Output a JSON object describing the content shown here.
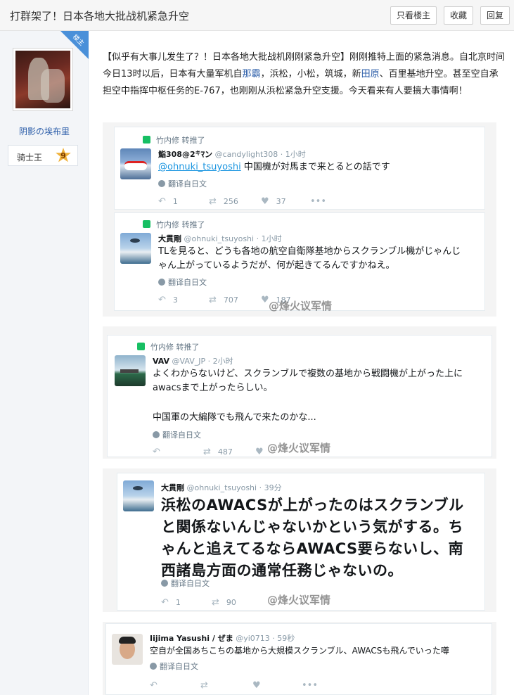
{
  "header": {
    "title": "打群架了！日本各地大批战机紧急升空",
    "buttons": {
      "author_only": "只看楼主",
      "favorite": "收藏",
      "reply": "回复"
    }
  },
  "user": {
    "corner_label": "楼主",
    "name": "阴影の埃布里",
    "rank_title": "骑士王",
    "rank_level": "9"
  },
  "post": {
    "text_before_naba": "【似乎有大事儿发生了？！日本各地大批战机刚刚紧急升空】刚刚推特上面的紧急消息。自北京时间今日13时以后，日本有大量军机自",
    "link_naba": "那霸",
    "text_between": "，浜松，小松，筑城，新",
    "link_tahara": "田原",
    "text_after": "、百里基地升空。甚至空自承担空中指挥中枢任务的E-767，也刚刚从浜松紧急升空支援。今天看来有人要搞大事情啊！"
  },
  "tweets": [
    {
      "retweet_label": "竹内修 转推了",
      "name": "鮨308@2",
      "name_suffix": "ﾏン",
      "handle": "@candylight308 · 1小时",
      "mention": "@ohnuki_tsuyoshi",
      "text": " 中国機が対馬まで来とるとの話です",
      "translate": "翻译自日文",
      "reply_count": "1",
      "retweet_count": "256",
      "like_count": "37"
    },
    {
      "retweet_label": "竹内修 转推了",
      "name": "大貫剛",
      "handle": "@ohnuki_tsuyoshi · 1小时",
      "text": "TLを見ると、どうも各地の航空自衛隊基地からスクランブル機がじゃんじゃん上がっているようだが、何が起きてるんですかねえ。",
      "translate": "翻译自日文",
      "reply_count": "3",
      "retweet_count": "707",
      "like_count": "187",
      "watermark": "@烽火议军情"
    },
    {
      "retweet_label": "竹内修 转推了",
      "name": "VAV",
      "handle": "@VAV_JP · 2小时",
      "text": "よくわからないけど、スクランブルで複数の基地から戦闘機が上がった上にawacsまで上がったらしい。",
      "text2": "中国軍の大編隊でも飛んで来たのかな...",
      "translate": "翻译自日文",
      "retweet_count": "487",
      "watermark": "@烽火议军情"
    },
    {
      "name": "大貫剛",
      "handle": "@ohnuki_tsuyoshi · 39分",
      "text": "浜松のAWACSが上がったのはスクランブルと関係ないんじゃないかという気がする。ちゃんと追えてるならAWACS要らないし、南西諸島方面の通常任務じゃないの。",
      "translate": "翻译自日文",
      "reply_count": "1",
      "retweet_count": "90",
      "watermark": "@烽火议军情"
    },
    {
      "name": "Iijima Yasushi / ぜま",
      "handle": "@yi0713 · 59秒",
      "text": "空自が全国あちこちの基地から大規模スクランブル、AWACSも飛んでいった噂",
      "translate": "翻译自日文"
    }
  ]
}
